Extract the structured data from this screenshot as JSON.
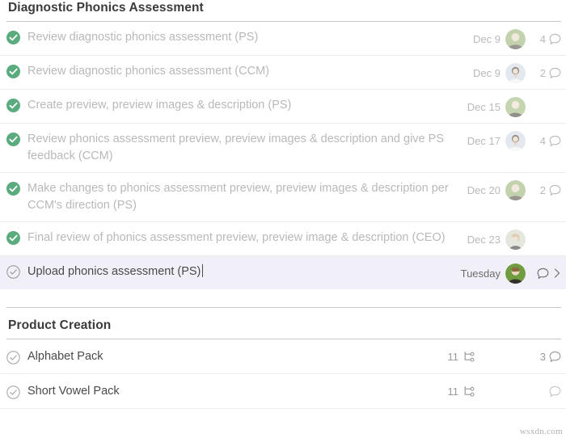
{
  "sections": [
    {
      "title": "Diagnostic Phonics Assessment",
      "tasks": [
        {
          "title": "Review diagnostic phonics assessment (PS)",
          "due": "Dec 9",
          "comments": "4",
          "status": "complete",
          "avatar_color": "#8fae6a",
          "selected": false,
          "chevron": false
        },
        {
          "title": "Review diagnostic phonics assessment (CCM)",
          "due": "Dec 9",
          "comments": "2",
          "status": "complete",
          "avatar_color": "#b6c6d6",
          "selected": false,
          "chevron": false
        },
        {
          "title": "Create preview, preview images & description (PS)",
          "due": "Dec 15",
          "comments": "",
          "status": "complete",
          "avatar_color": "#94b36e",
          "selected": false,
          "chevron": false
        },
        {
          "title": "Review phonics assessment preview, preview images & description and give PS feedback (CCM)",
          "due": "Dec 17",
          "comments": "4",
          "status": "complete",
          "avatar_color": "#b9cad8",
          "selected": false,
          "chevron": false
        },
        {
          "title": "Make changes to phonics assessment preview, preview images & description per CCM's direction (PS)",
          "due": "Dec 20",
          "comments": "2",
          "status": "complete",
          "avatar_color": "#8fae6a",
          "selected": false,
          "chevron": false
        },
        {
          "title": "Final review of phonics assessment preview, preview image & description (CEO)",
          "due": "Dec 23",
          "comments": "",
          "status": "complete",
          "avatar_color": "#c3b79a",
          "selected": false,
          "chevron": false
        },
        {
          "title": "Upload phonics assessment (PS)",
          "due": "Tuesday",
          "comments": "",
          "status": "incomplete",
          "avatar_color": "#6f9c3f",
          "selected": true,
          "chevron": true
        }
      ]
    },
    {
      "title": "Product Creation",
      "products": [
        {
          "title": "Alphabet Pack",
          "subtasks": "11",
          "comments": "3",
          "status": "incomplete"
        },
        {
          "title": "Short Vowel Pack",
          "subtasks": "11",
          "comments": "",
          "status": "incomplete"
        }
      ]
    }
  ],
  "icons": {
    "check_complete": "check-circle-filled-icon",
    "check_incomplete": "check-circle-outline-icon",
    "comment": "comment-bubble-icon",
    "subtask": "subtask-tree-icon",
    "chevron": "chevron-right-icon",
    "avatar": "user-avatar"
  },
  "colors": {
    "complete_green": "#5aab7e",
    "selected_row_bg": "#f1f0f9",
    "muted_text": "#b9b9b9",
    "active_text": "#4a4a4a",
    "divider": "#ececec",
    "header_rule": "#c9c9c9"
  },
  "watermark": "wsxdn.com"
}
